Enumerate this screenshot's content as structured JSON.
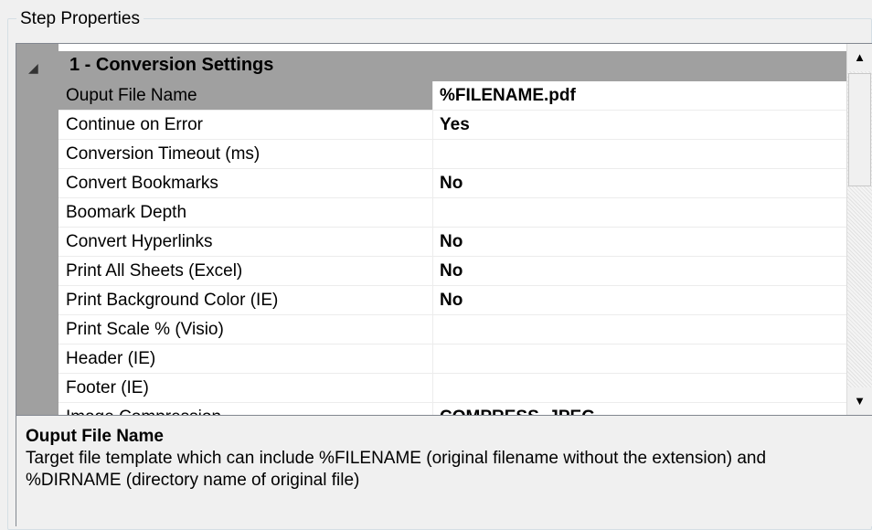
{
  "group_title": "Step Properties",
  "category": {
    "collapse_glyph": "◢",
    "label": "1 - Conversion Settings"
  },
  "properties": [
    {
      "name": "Ouput File Name",
      "value": "%FILENAME.pdf"
    },
    {
      "name": "Continue on Error",
      "value": "Yes"
    },
    {
      "name": "Conversion Timeout (ms)",
      "value": ""
    },
    {
      "name": "Convert Bookmarks",
      "value": "No"
    },
    {
      "name": "Boomark Depth",
      "value": ""
    },
    {
      "name": "Convert Hyperlinks",
      "value": "No"
    },
    {
      "name": "Print All Sheets (Excel)",
      "value": "No"
    },
    {
      "name": "Print Background Color (IE)",
      "value": "No"
    },
    {
      "name": "Print Scale % (Visio)",
      "value": ""
    },
    {
      "name": "Header (IE)",
      "value": ""
    },
    {
      "name": "Footer (IE)",
      "value": ""
    },
    {
      "name": "Image Compression",
      "value": "COMPRESS_JPEG"
    }
  ],
  "selected_index": 0,
  "scrollbar": {
    "up_glyph": "▲",
    "down_glyph": "▼"
  },
  "help": {
    "title": "Ouput File Name",
    "description": "Target file template which can include %FILENAME (original filename without the extension) and %DIRNAME (directory name of original file)"
  },
  "colors": {
    "category_bg": "#a0a0a0",
    "grid_bg": "#ffffff",
    "window_bg": "#f0f0f0"
  }
}
